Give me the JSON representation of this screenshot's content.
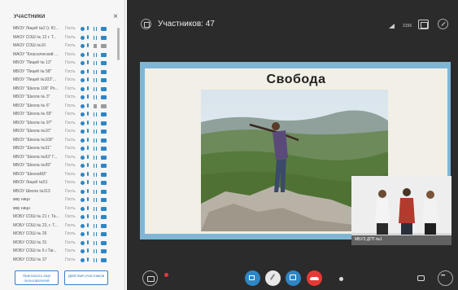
{
  "panel": {
    "title": "УЧАСТНИКИ",
    "close_icon": "×",
    "participants": [
      {
        "name": "МБОУ Лицей №2 (г. Ю...",
        "role": "Гость",
        "dim": false
      },
      {
        "name": "МАОУ СОШ № 12 г. Т...",
        "role": "Гость",
        "dim": false
      },
      {
        "name": "МАОУ СОШ №10",
        "role": "Гость",
        "dim": true
      },
      {
        "name": "МАОУ \"Классический ...",
        "role": "Гость",
        "dim": false
      },
      {
        "name": "МБОУ \"Лицей № 13\"",
        "role": "Гость",
        "dim": false
      },
      {
        "name": "МБОУ \"Лицей № 58\"",
        "role": "Гость",
        "dim": false
      },
      {
        "name": "МБОУ \"Лицей №103\"...",
        "role": "Гость",
        "dim": false
      },
      {
        "name": "МБОУ \"Школа 100\" Ро...",
        "role": "Гость",
        "dim": false
      },
      {
        "name": "МБОУ \"Школа № 3\"",
        "role": "Гость",
        "dim": false
      },
      {
        "name": "МБОУ \"Школа № 6\"",
        "role": "Гость",
        "dim": true
      },
      {
        "name": "МБОУ \"Школа № 65\"",
        "role": "Гость",
        "dim": false
      },
      {
        "name": "МБОУ \"Школа № 97\"",
        "role": "Гость",
        "dim": false
      },
      {
        "name": "МБОУ \"Школа №10\"",
        "role": "Гость",
        "dim": false
      },
      {
        "name": "МБОУ \"Школа №108\"",
        "role": "Гость",
        "dim": false
      },
      {
        "name": "МБОУ \"Школа №31\"",
        "role": "Гость",
        "dim": false
      },
      {
        "name": "МБОУ \"Школа №63\" Г...",
        "role": "Гость",
        "dim": false
      },
      {
        "name": "МБОУ \"Школа №99\"",
        "role": "Гость",
        "dim": false
      },
      {
        "name": "МБОУ \"ШколаМ3\"",
        "role": "Гость",
        "dim": false
      },
      {
        "name": "МБОУ Лицей №51",
        "role": "Гость",
        "dim": false
      },
      {
        "name": "МБОУ Школа №113",
        "role": "Гость",
        "dim": false
      },
      {
        "name": "мву ницн",
        "role": "Гость",
        "dim": false
      },
      {
        "name": "мву ницн",
        "role": "Гость",
        "dim": false
      },
      {
        "name": "МОБУ СОШ № 21 г. Та...",
        "role": "Гость",
        "dim": false
      },
      {
        "name": "МОБУ СОШ № 23, г. Т...",
        "role": "Гость",
        "dim": false
      },
      {
        "name": "МОБУ СОШ № 26",
        "role": "Гость",
        "dim": false
      },
      {
        "name": "МОБУ СОШ № 31",
        "role": "Гость",
        "dim": false
      },
      {
        "name": "МОБУ СОШ № 6 г.Таг...",
        "role": "Гость",
        "dim": false
      },
      {
        "name": "МОБУ СОШ № 37",
        "role": "Гость",
        "dim": false
      }
    ],
    "invite_label": "Пригласить еще пользователей",
    "actions_label": "Действия участников"
  },
  "topbar": {
    "participants_count": "Участников: 47",
    "speed": "3156"
  },
  "slide": {
    "title": "Свобода"
  },
  "inset": {
    "label": "МБУЗ ДГП №1"
  },
  "colors": {
    "accent": "#2f86c4",
    "end_call": "#e53935",
    "slide_frame": "#7fb6d6",
    "background": "#2b2b2b"
  }
}
